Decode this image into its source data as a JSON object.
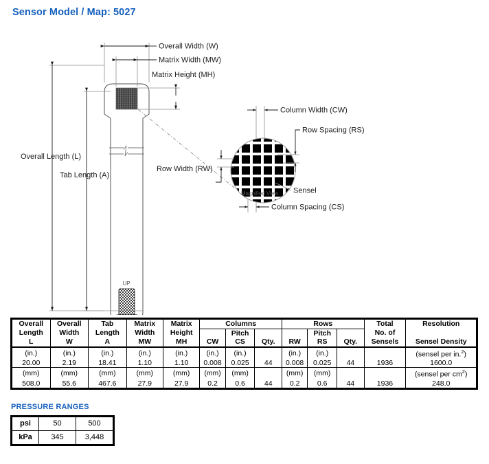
{
  "title": "Sensor Model / Map: 5027",
  "accent_color": "#1560bd",
  "diagram": {
    "labels": {
      "overall_width": "Overall Width (W)",
      "matrix_width": "Matrix Width (MW)",
      "matrix_height": "Matrix Height (MH)",
      "overall_length": "Overall Length (L)",
      "tab_length": "Tab Length (A)",
      "row_width": "Row Width (RW)",
      "column_width": "Column Width (CW)",
      "row_spacing": "Row Spacing (RS)",
      "sensel": "Sensel",
      "column_spacing": "Column Spacing (CS)",
      "magnified_view": "Magnified View",
      "up_marking": "UP"
    }
  },
  "spec_table": {
    "group_headers": [
      {
        "label": "Columns",
        "span": 3
      },
      {
        "label": "Rows",
        "span": 3
      }
    ],
    "columns": [
      {
        "l1": "Overall",
        "l2": "Length",
        "l3": "L"
      },
      {
        "l1": "Overall",
        "l2": "Width",
        "l3": "W"
      },
      {
        "l1": "Tab",
        "l2": "Length",
        "l3": "A"
      },
      {
        "l1": "Matrix",
        "l2": "Width",
        "l3": "MW"
      },
      {
        "l1": "Matrix",
        "l2": "Height",
        "l3": "MH"
      },
      {
        "l1": "",
        "l2": "",
        "l3": "CW"
      },
      {
        "l1": "",
        "l2": "Pitch",
        "l3": "CS"
      },
      {
        "l1": "",
        "l2": "",
        "l3": "Qty."
      },
      {
        "l1": "",
        "l2": "",
        "l3": "RW"
      },
      {
        "l1": "",
        "l2": "Pitch",
        "l3": "RS"
      },
      {
        "l1": "",
        "l2": "",
        "l3": "Qty."
      },
      {
        "l1": "Total",
        "l2": "No. of",
        "l3": "Sensels"
      },
      {
        "l1": "Resolution",
        "l2": "",
        "l3": "Sensel Density"
      }
    ],
    "rows": [
      {
        "units": [
          "(in.)",
          "(in.)",
          "(in.)",
          "(in.)",
          "(in.)",
          "(in.)",
          "(in.)",
          "",
          "(in.)",
          "(in.)",
          "",
          "",
          "(sensel per in."
        ],
        "unit_sup": "2",
        "unit_tail": ")",
        "values": [
          "20.00",
          "2.19",
          "18.41",
          "1.10",
          "1.10",
          "0.008",
          "0.025",
          "44",
          "0.008",
          "0.025",
          "44",
          "1936",
          "1600.0"
        ]
      },
      {
        "units": [
          "(mm)",
          "(mm)",
          "(mm)",
          "(mm)",
          "(mm)",
          "(mm)",
          "(mm)",
          "",
          "(mm)",
          "(mm)",
          "",
          "",
          "(sensel per cm"
        ],
        "unit_sup": "2",
        "unit_tail": ")",
        "values": [
          "508.0",
          "55.6",
          "467.6",
          "27.9",
          "27.9",
          "0.2",
          "0.6",
          "44",
          "0.2",
          "0.6",
          "44",
          "1936",
          "248.0"
        ]
      }
    ]
  },
  "pressure_ranges": {
    "title": "PRESSURE RANGES",
    "rows": [
      {
        "unit": "psi",
        "values": [
          "50",
          "500"
        ]
      },
      {
        "unit": "kPa",
        "values": [
          "345",
          "3,448"
        ]
      }
    ]
  }
}
